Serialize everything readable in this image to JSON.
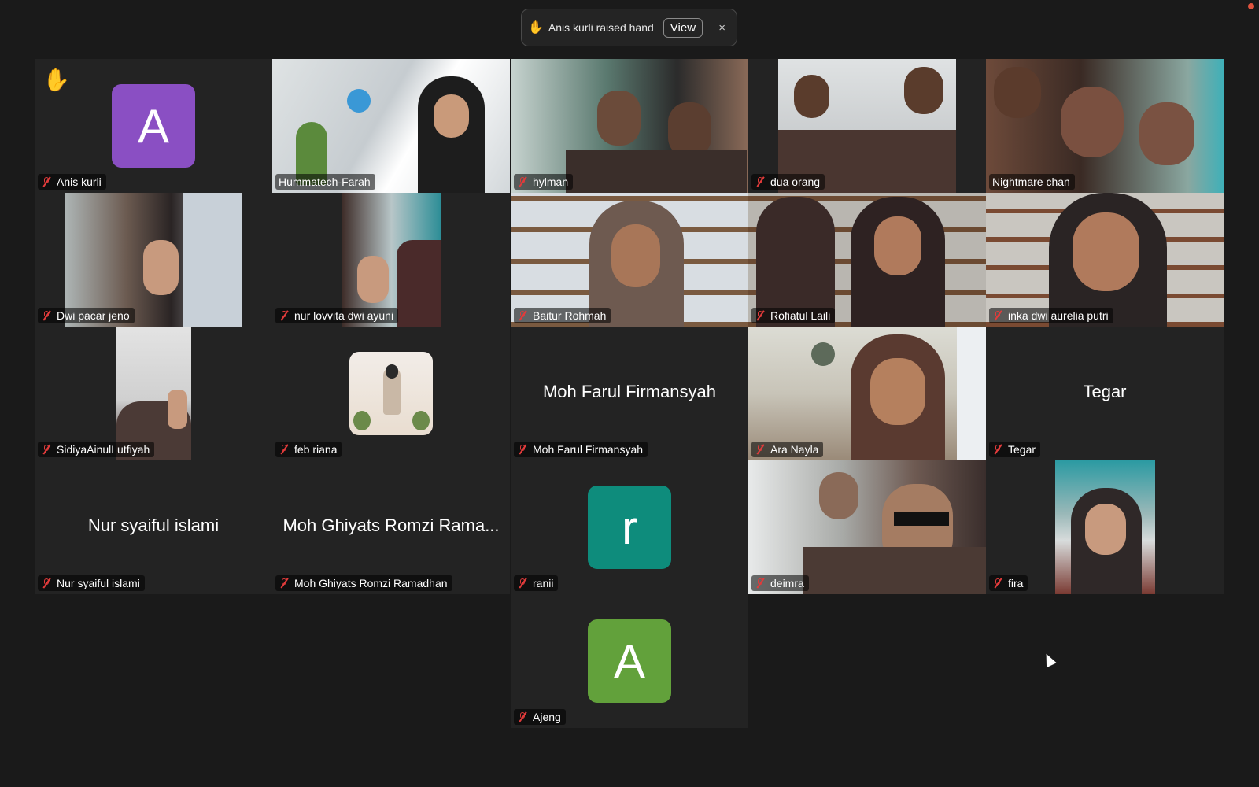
{
  "notification": {
    "message": "Anis kurli raised hand",
    "view_label": "View",
    "close_label": "×"
  },
  "colors": {
    "background": "#1a1a1a",
    "tile": "#232323",
    "active_speaker_border": "#3fd15b",
    "mute_red": "#e23b3b",
    "avatar_purple": "#8a4fc3",
    "avatar_teal": "#0e8c7c",
    "avatar_green": "#62a13b"
  },
  "participants": [
    {
      "name": "Anis kurli",
      "type": "avatar",
      "initial": "A",
      "raised_hand": true,
      "muted": true
    },
    {
      "name": "Hummatech-Farah",
      "type": "video",
      "active_speaker": true,
      "muted": false
    },
    {
      "name": "hylman",
      "type": "video",
      "muted": true
    },
    {
      "name": "dua orang",
      "type": "video",
      "muted": true
    },
    {
      "name": "Nightmare chan",
      "type": "video",
      "muted": false
    },
    {
      "name": "Dwi pacar jeno",
      "type": "video",
      "muted": true
    },
    {
      "name": "nur lovvita dwi ayuni",
      "type": "video",
      "muted": true
    },
    {
      "name": "Baitur Rohmah",
      "type": "video",
      "muted": true
    },
    {
      "name": "Rofiatul Laili",
      "type": "video",
      "muted": true
    },
    {
      "name": "inka dwi aurelia putri",
      "type": "video",
      "muted": true
    },
    {
      "name": "SidiyaAinulLutfiyah",
      "type": "video",
      "muted": true
    },
    {
      "name": "feb riana",
      "type": "profile_photo",
      "muted": true
    },
    {
      "name": "Moh Farul Firmansyah",
      "type": "name_only",
      "display": "Moh Farul Firmansyah",
      "muted": true
    },
    {
      "name": "Ara Nayla",
      "type": "video",
      "muted": true
    },
    {
      "name": "Tegar",
      "type": "name_only",
      "display": "Tegar",
      "muted": true
    },
    {
      "name": "Nur syaiful islami",
      "type": "name_only",
      "display": "Nur syaiful islami",
      "muted": true
    },
    {
      "name": "Moh Ghiyats Romzi Ramadhan",
      "type": "name_only",
      "display": "Moh Ghiyats Romzi Rama...",
      "muted": true
    },
    {
      "name": "ranii",
      "type": "avatar",
      "initial": "r",
      "muted": true
    },
    {
      "name": "deimra",
      "type": "video",
      "muted": true
    },
    {
      "name": "fira",
      "type": "video",
      "muted": true
    },
    {
      "name": "Ajeng",
      "type": "avatar",
      "initial": "A",
      "muted": true
    }
  ]
}
